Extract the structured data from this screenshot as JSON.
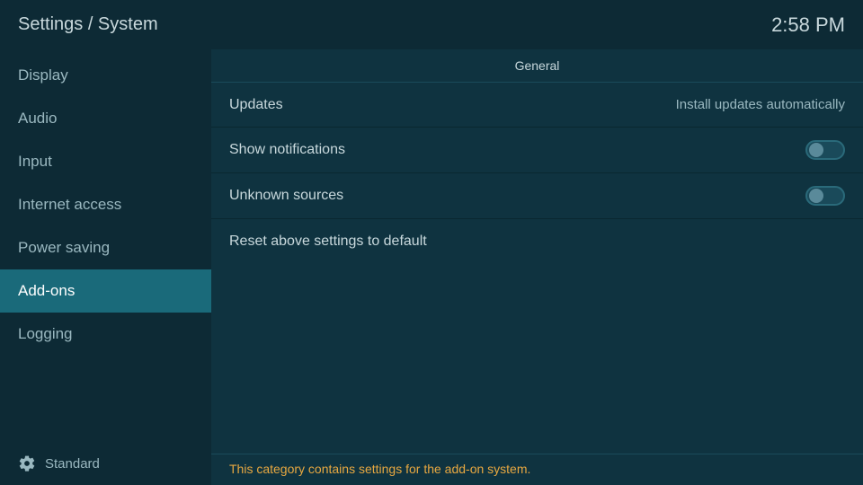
{
  "header": {
    "title": "Settings / System",
    "time": "2:58 PM"
  },
  "sidebar": {
    "items": [
      {
        "id": "display",
        "label": "Display",
        "active": false
      },
      {
        "id": "audio",
        "label": "Audio",
        "active": false
      },
      {
        "id": "input",
        "label": "Input",
        "active": false
      },
      {
        "id": "internet-access",
        "label": "Internet access",
        "active": false
      },
      {
        "id": "power-saving",
        "label": "Power saving",
        "active": false
      },
      {
        "id": "add-ons",
        "label": "Add-ons",
        "active": true
      },
      {
        "id": "logging",
        "label": "Logging",
        "active": false
      }
    ],
    "footer_label": "Standard"
  },
  "content": {
    "section_label": "General",
    "rows": [
      {
        "id": "updates",
        "label": "Updates",
        "value": "Install updates automatically",
        "type": "value"
      },
      {
        "id": "show-notifications",
        "label": "Show notifications",
        "value": null,
        "type": "toggle",
        "toggled": false
      },
      {
        "id": "unknown-sources",
        "label": "Unknown sources",
        "value": null,
        "type": "toggle",
        "toggled": false
      },
      {
        "id": "reset-settings",
        "label": "Reset above settings to default",
        "value": null,
        "type": "action"
      }
    ],
    "footer_text": "This category contains settings for the add-on system."
  }
}
